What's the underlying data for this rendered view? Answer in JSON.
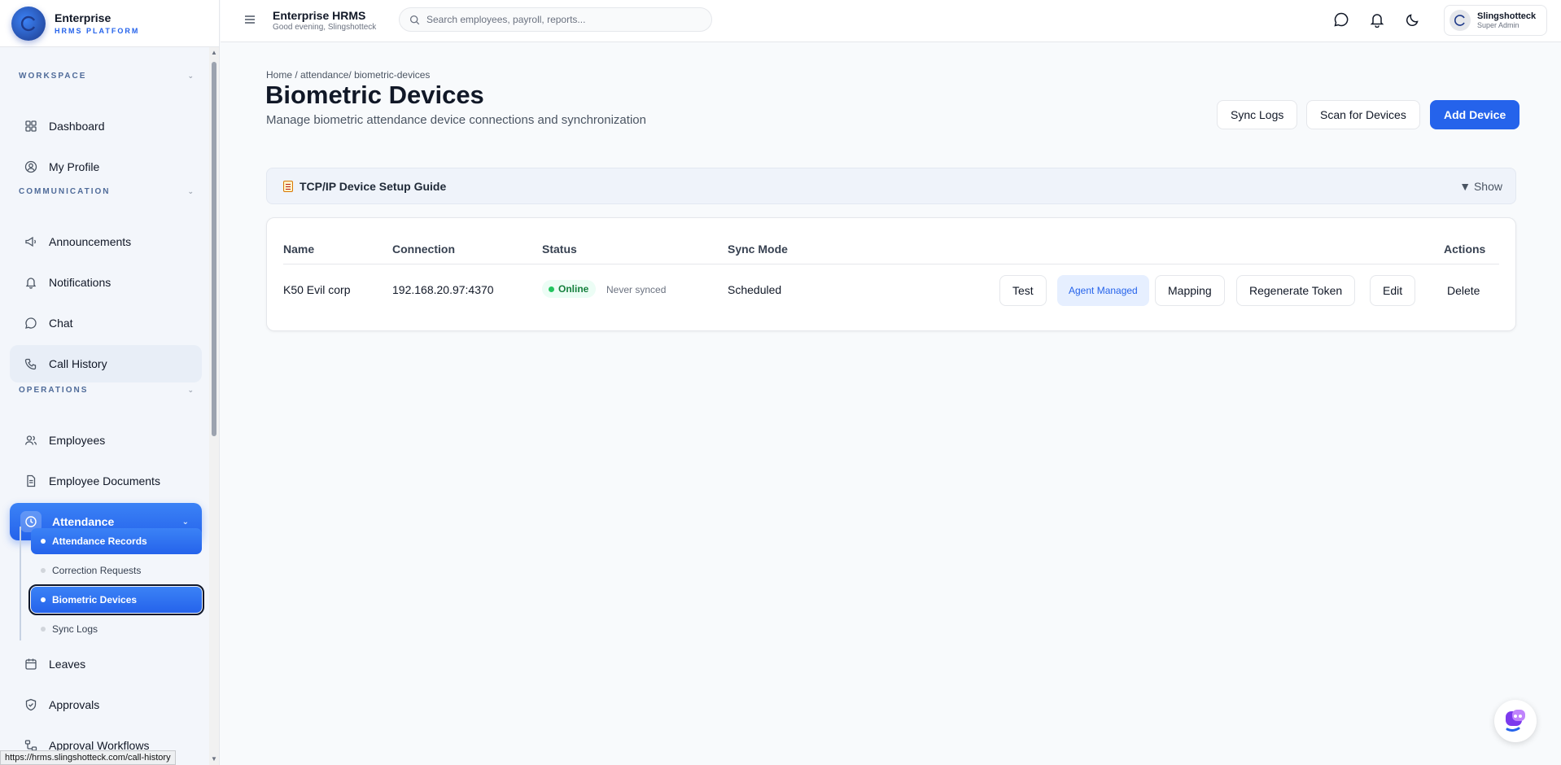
{
  "brand": {
    "title": "Enterprise",
    "subtitle": "HRMS PLATFORM"
  },
  "sidebar": {
    "sections": [
      {
        "label": "WORKSPACE"
      },
      {
        "label": "COMMUNICATION"
      },
      {
        "label": "OPERATIONS"
      }
    ],
    "items": [
      {
        "label": "Dashboard",
        "icon": "grid-icon"
      },
      {
        "label": "My Profile",
        "icon": "user-circle-icon"
      },
      {
        "label": "Announcements",
        "icon": "megaphone-icon"
      },
      {
        "label": "Notifications",
        "icon": "bell-icon"
      },
      {
        "label": "Chat",
        "icon": "chat-bubble-icon"
      },
      {
        "label": "Call History",
        "icon": "phone-icon"
      },
      {
        "label": "Employees",
        "icon": "users-icon"
      },
      {
        "label": "Employee Documents",
        "icon": "document-icon"
      },
      {
        "label": "Attendance",
        "icon": "clock-icon"
      },
      {
        "label": "Leaves",
        "icon": "calendar-icon"
      },
      {
        "label": "Approvals",
        "icon": "shield-check-icon"
      },
      {
        "label": "Approval Workflows",
        "icon": "workflow-icon"
      }
    ],
    "attendance_sub": [
      {
        "label": "Attendance Records"
      },
      {
        "label": "Correction Requests"
      },
      {
        "label": "Biometric Devices"
      },
      {
        "label": "Sync Logs"
      }
    ]
  },
  "status_url": "https://hrms.slingshotteck.com/call-history",
  "topbar": {
    "title": "Enterprise HRMS",
    "greeting": "Good evening, Slingshotteck",
    "search_placeholder": "Search employees, payroll, reports...",
    "user_name": "Slingshotteck",
    "user_role": "Super Admin"
  },
  "page": {
    "breadcrumb": "Home / attendance/ biometric-devices",
    "title": "Biometric Devices",
    "subtitle": "Manage biometric attendance device connections and synchronization",
    "buttons": {
      "sync_logs": "Sync Logs",
      "scan": "Scan for Devices",
      "add": "Add Device"
    },
    "guide": {
      "title": "TCP/IP Device Setup Guide",
      "toggle": "▼ Show"
    }
  },
  "table": {
    "headers": {
      "name": "Name",
      "connection": "Connection",
      "status": "Status",
      "sync_mode": "Sync Mode",
      "actions": "Actions"
    },
    "rows": [
      {
        "name": "K50 Evil corp",
        "connection": "192.168.20.97:4370",
        "status": "Online",
        "sync_note": "Never synced",
        "sync_mode": "Scheduled",
        "actions": {
          "test": "Test",
          "agent": "Agent Managed",
          "mapping": "Mapping",
          "regenerate": "Regenerate Token",
          "edit": "Edit",
          "delete": "Delete"
        }
      }
    ]
  },
  "colors": {
    "accent": "#2563eb",
    "online": "#15803d",
    "sidebar_bg": "#f3f6fb"
  }
}
